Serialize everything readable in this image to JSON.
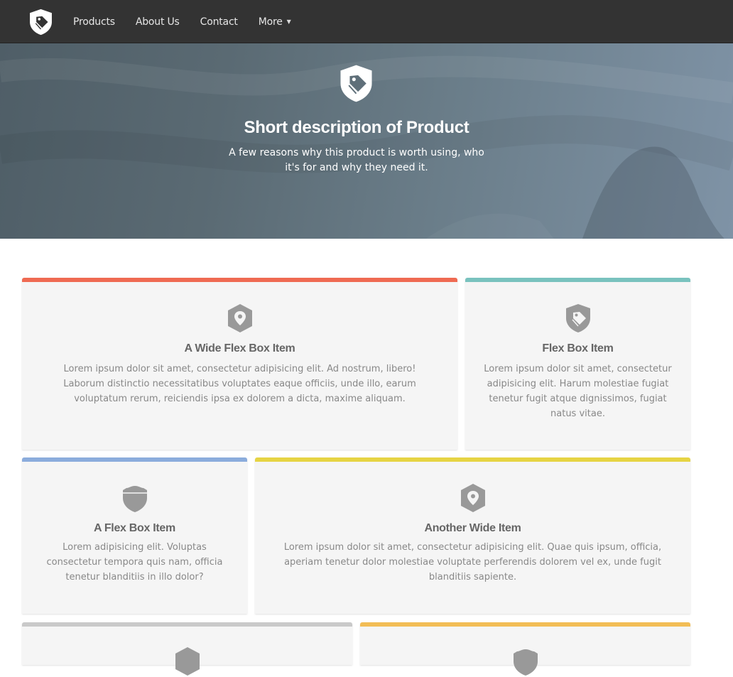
{
  "nav": {
    "items": [
      {
        "label": "Products"
      },
      {
        "label": "About Us"
      },
      {
        "label": "Contact"
      },
      {
        "label": "More"
      }
    ]
  },
  "hero": {
    "title": "Short description of Product",
    "subtitle": "A few reasons why this product is worth using, who it's for and why they need it."
  },
  "cards": [
    {
      "title": "A Wide Flex Box Item",
      "icon": "map-pin-icon",
      "accent": "#ef6a52",
      "text": "Lorem ipsum dolor sit amet, consectetur adipisicing elit. Ad nostrum, libero! Laborum distinctio necessitatibus voluptates eaque officiis, unde illo, earum voluptatum rerum, reiciendis ipsa ex dolorem a dicta, maxime aliquam."
    },
    {
      "title": "Flex Box Item",
      "icon": "tag-shield-icon",
      "accent": "#79c2be",
      "text": "Lorem ipsum dolor sit amet, consectetur adipisicing elit. Harum molestiae fugiat tenetur fugit atque dignissimos, fugiat natus vitae."
    },
    {
      "title": "A Flex Box Item",
      "icon": "badge-shield-icon",
      "accent": "#8bacdc",
      "text": "Lorem adipisicing elit. Voluptas consectetur tempora quis nam, officia tenetur blanditiis in illo dolor?"
    },
    {
      "title": "Another Wide Item",
      "icon": "map-pin-icon",
      "accent": "#e6d444",
      "text": "Lorem ipsum dolor sit amet, consectetur adipisicing elit. Quae quis ipsum, officia, aperiam tenetur dolor molestiae voluptate perferendis dolorem vel ex, unde fugit blanditiis sapiente."
    },
    {
      "title": "",
      "icon": "map-pin-icon",
      "accent": "#c9c9c9",
      "text": ""
    },
    {
      "title": "",
      "icon": "badge-shield-icon",
      "accent": "#f2bd55",
      "text": ""
    }
  ]
}
